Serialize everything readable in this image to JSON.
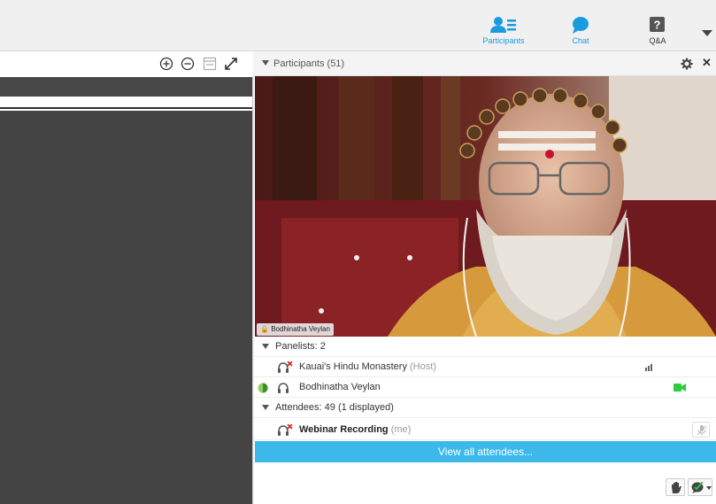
{
  "toolbar": {
    "participants_label": "Participants",
    "chat_label": "Chat",
    "qa_label": "Q&A",
    "qa_glyph": "?"
  },
  "participants_panel": {
    "title": "Participants (51)",
    "video_caption": "Bodhinatha Veylan",
    "panelists_header": "Panelists: 2",
    "panelists": [
      {
        "name": "Kauai's Hindu Monastery",
        "role": "(Host)",
        "muted": true,
        "audio_bars": true
      },
      {
        "name": "Bodhinatha Veylan",
        "role": "",
        "muted": false,
        "video_on": true
      }
    ],
    "attendees_header": "Attendees: 49 (1 displayed)",
    "attendees": [
      {
        "name": "Webinar Recording",
        "role": "(me)",
        "muted": true
      }
    ],
    "view_all_label": "View all attendees..."
  },
  "colors": {
    "accent": "#1a9be0",
    "view_all_bg": "#3cb9ea",
    "video_on": "#2ecc40",
    "muted": "#d9231d"
  }
}
